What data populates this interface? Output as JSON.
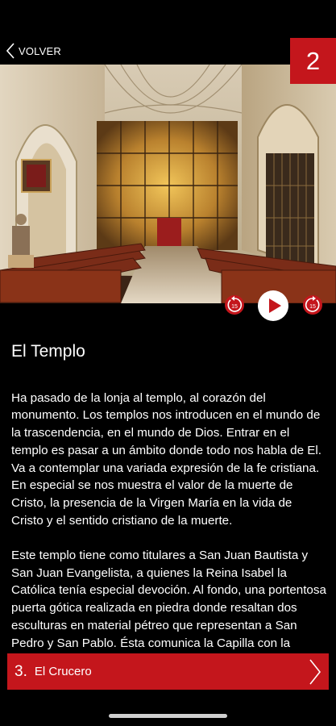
{
  "header": {
    "back_label": "VOLVER",
    "stop_number": "2"
  },
  "player": {
    "rewind_label": "15",
    "forward_label": "15"
  },
  "content": {
    "title": "El Templo",
    "paragraphs": [
      "Ha pasado de la lonja al templo, al corazón del monumento. Los templos nos introducen en el mundo de la trascendencia, en el mundo de Dios. Entrar en el templo es pasar a un ámbito donde todo nos habla de El. Va a contemplar una variada expresión de la fe cristiana. En especial se nos muestra el valor de la muerte de Cristo, la presencia de la Virgen María en la vida de Cristo y el sentido cristiano de la muerte.",
      "Este templo tiene como titulares a San Juan Bautista y San Juan Evangelista, a quienes la Reina Isabel la Católica tenía especial devoción. Al fondo, una portentosa puerta gótica realizada en piedra donde resaltan dos esculturas en material pétreo que representan a San Pedro y San Pablo. Ésta comunica la Capilla con la Iglesia"
    ]
  },
  "next": {
    "number": "3.",
    "label": "El Crucero"
  },
  "colors": {
    "accent": "#c4161c",
    "background": "#000000",
    "text": "#ffffff"
  },
  "icons": {
    "back": "chevron-left-icon",
    "rewind": "rewind-15-icon",
    "play": "play-icon",
    "forward": "forward-15-icon",
    "next": "chevron-right-icon"
  }
}
